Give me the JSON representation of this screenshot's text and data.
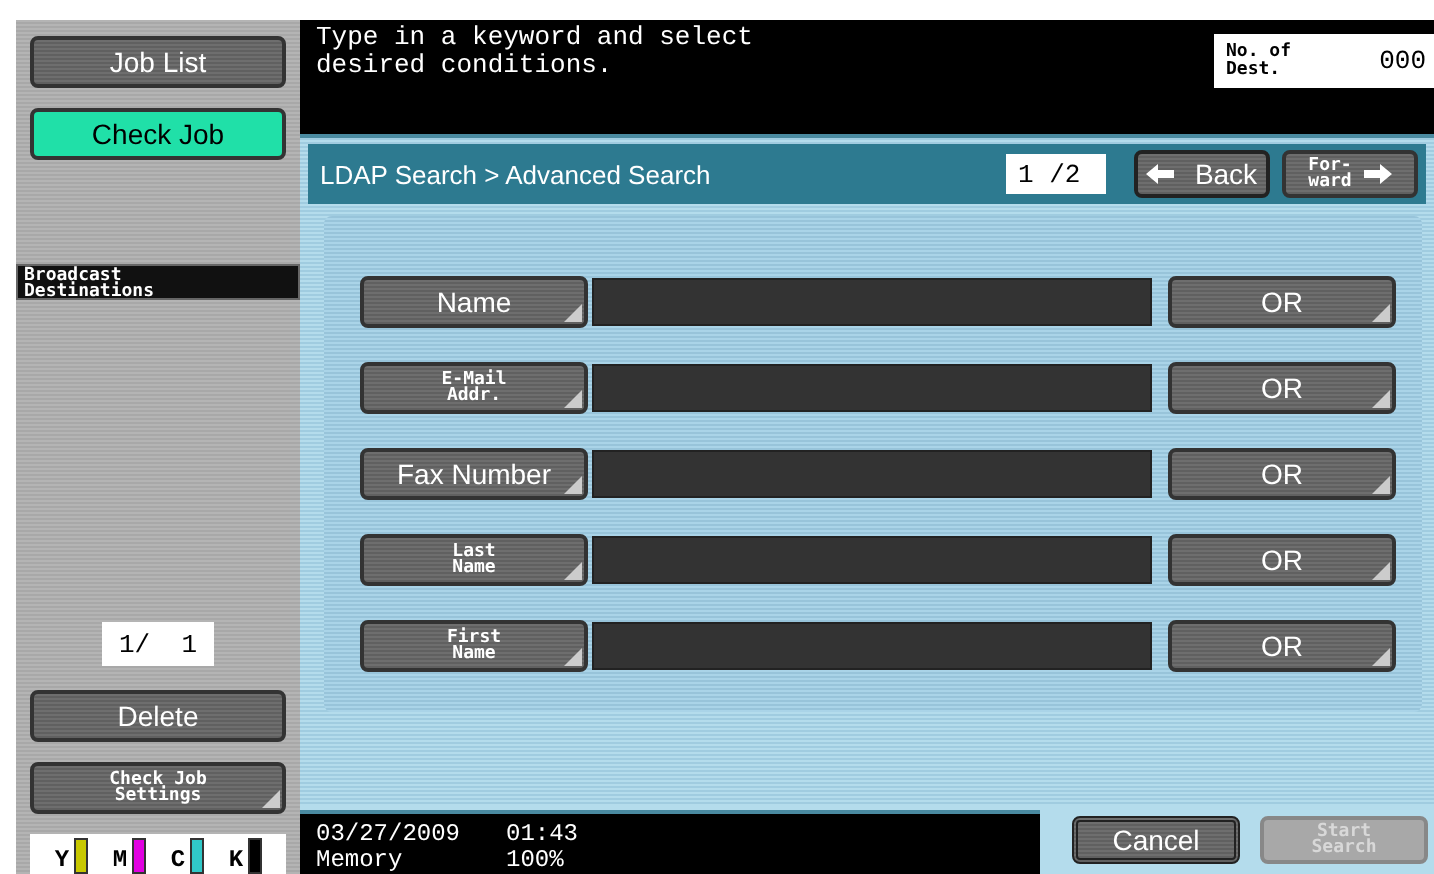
{
  "sidebar": {
    "buttons": [
      {
        "label": "Job List",
        "selected": false
      },
      {
        "label": "Check Job",
        "selected": true
      }
    ],
    "section_label": "Broadcast\nDestinations",
    "page_counter": "1/  1",
    "delete_button": "Delete",
    "settings_button": "Check Job\nSettings",
    "toners": [
      {
        "label": "Y",
        "color": "#c8c800"
      },
      {
        "label": "M",
        "color": "#e000e0"
      },
      {
        "label": "C",
        "color": "#30c8c8"
      },
      {
        "label": "K",
        "color": "#000000"
      }
    ]
  },
  "header": {
    "message": "Type in a keyword and select\ndesired conditions.",
    "dest_label": "No. of\nDest.",
    "dest_count": "000"
  },
  "panel": {
    "title": "LDAP Search > Advanced Search",
    "page": "1 /2",
    "back": "Back",
    "forward": "For-\nward",
    "rows": [
      {
        "label": "Name",
        "value": "",
        "condition": "OR"
      },
      {
        "label": "E-Mail\nAddr.",
        "value": "",
        "condition": "OR"
      },
      {
        "label": "Fax Number",
        "value": "",
        "condition": "OR"
      },
      {
        "label": "Last\nName",
        "value": "",
        "condition": "OR"
      },
      {
        "label": "First\nName",
        "value": "",
        "condition": "OR"
      }
    ]
  },
  "status": {
    "date": "03/27/2009",
    "time": "01:43",
    "memory_label": "Memory",
    "memory_value": "100%"
  },
  "footer": {
    "cancel": "Cancel",
    "start": {
      "label": "Start\nSearch",
      "disabled": true
    }
  }
}
